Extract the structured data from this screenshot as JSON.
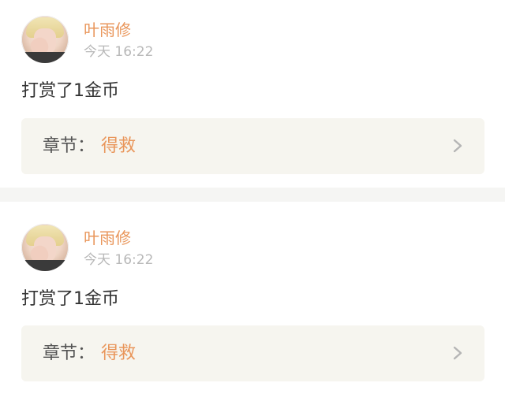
{
  "feed": {
    "items": [
      {
        "username": "叶雨修",
        "time": "今天 16:22",
        "message": "打赏了1金币",
        "chapter_label": "章节：",
        "chapter_title": "得救",
        "icons": {
          "avatar": "user-avatar",
          "chevron": "chevron-right-icon"
        }
      },
      {
        "username": "叶雨修",
        "time": "今天 16:22",
        "message": "打赏了1金币",
        "chapter_label": "章节：",
        "chapter_title": "得救",
        "icons": {
          "avatar": "user-avatar",
          "chevron": "chevron-right-icon"
        }
      }
    ]
  },
  "colors": {
    "accent": "#e9965b",
    "muted_text": "#b8b8b8",
    "body_text": "#333333",
    "card_bg": "#f6f5ef",
    "divider_bg": "#f5f5f3"
  }
}
